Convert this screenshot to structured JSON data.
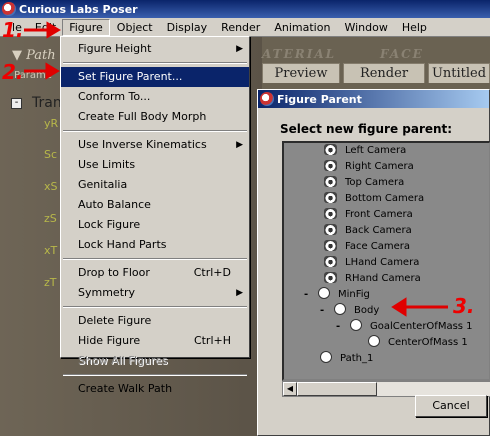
{
  "window": {
    "title": "Curious Labs Poser"
  },
  "menubar": {
    "items": [
      "ile",
      "Edit",
      "Figure",
      "Object",
      "Display",
      "Render",
      "Animation",
      "Window",
      "Help"
    ]
  },
  "background": {
    "panel_title": "Path",
    "panel_sub": "Parame",
    "tree_toggle": "-",
    "tree_label": "Tran",
    "params": [
      "yR",
      "Sc",
      "xS",
      "zS",
      "xT",
      "zT"
    ],
    "ghost_tabs": [
      "ATERIAL",
      "FACE"
    ],
    "tabs": [
      "Preview",
      "Render",
      "Untitled"
    ]
  },
  "figure_menu": {
    "items": [
      {
        "label": "Figure Height",
        "submenu": true
      },
      {
        "separator": true
      },
      {
        "label": "Set Figure Parent...",
        "selected": true
      },
      {
        "label": "Conform To..."
      },
      {
        "label": "Create Full Body Morph"
      },
      {
        "separator": true
      },
      {
        "label": "Use Inverse Kinematics",
        "submenu": true
      },
      {
        "label": "Use Limits"
      },
      {
        "label": "Genitalia"
      },
      {
        "label": "Auto Balance"
      },
      {
        "label": "Lock Figure"
      },
      {
        "label": "Lock Hand Parts"
      },
      {
        "separator": true
      },
      {
        "label": "Drop to Floor",
        "shortcut": "Ctrl+D"
      },
      {
        "label": "Symmetry",
        "submenu": true
      },
      {
        "separator": true
      },
      {
        "label": "Delete Figure"
      },
      {
        "label": "Hide  Figure",
        "shortcut": "Ctrl+H"
      },
      {
        "label": "Show All Figures",
        "disabled": true
      },
      {
        "separator": true
      },
      {
        "label": "Create Walk Path"
      }
    ]
  },
  "dialog": {
    "title": "Figure Parent",
    "prompt": "Select new figure parent:",
    "list": [
      {
        "label": "Left Camera",
        "icon": "camera",
        "prefix": ""
      },
      {
        "label": "Right Camera",
        "icon": "camera",
        "prefix": ""
      },
      {
        "label": "Top Camera",
        "icon": "camera",
        "prefix": ""
      },
      {
        "label": "Bottom Camera",
        "icon": "camera",
        "prefix": ""
      },
      {
        "label": "Front Camera",
        "icon": "camera",
        "prefix": ""
      },
      {
        "label": "Back Camera",
        "icon": "camera",
        "prefix": ""
      },
      {
        "label": "Face Camera",
        "icon": "camera",
        "prefix": ""
      },
      {
        "label": "LHand Camera",
        "icon": "camera",
        "prefix": ""
      },
      {
        "label": "RHand Camera",
        "icon": "camera",
        "prefix": ""
      },
      {
        "label": "MinFig",
        "icon": "figure",
        "prefix": "-"
      },
      {
        "label": "Body",
        "icon": "body",
        "prefix": "-"
      },
      {
        "label": "GoalCenterOfMass 1",
        "icon": "prop",
        "prefix": "-"
      },
      {
        "label": "CenterOfMass 1",
        "icon": "prop",
        "prefix": ""
      },
      {
        "label": "Path_1",
        "icon": "prop",
        "prefix": ""
      }
    ],
    "cancel_label": "Cancel"
  },
  "annotations": [
    "1.",
    "2.",
    "3."
  ],
  "colors": {
    "annotation": "#e00000",
    "selection": "#0a246a",
    "titlebar": "#0a246a"
  }
}
